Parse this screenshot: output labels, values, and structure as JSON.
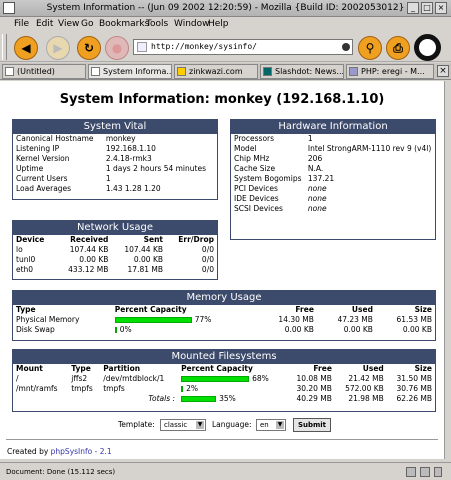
{
  "window": {
    "title": "System Information -- (Jun 09 2002 12:20:59) - Mozilla {Build ID: 2002053012}"
  },
  "menu": [
    "File",
    "Edit",
    "View",
    "Go",
    "Bookmarks",
    "Tools",
    "Window",
    "Help"
  ],
  "toolbar": {
    "url": "http://monkey/sysinfo/"
  },
  "tabs": [
    "(Untitled)",
    "System Informa...",
    "zinkwazi.com",
    "Slashdot: News...",
    "PHP: eregi - M..."
  ],
  "page": {
    "title": "System Information: monkey (192.168.1.10)"
  },
  "vital": {
    "heading": "System Vital",
    "rows": [
      {
        "k": "Canonical Hostname",
        "v": "monkey"
      },
      {
        "k": "Listening IP",
        "v": "192.168.1.10"
      },
      {
        "k": "Kernel Version",
        "v": "2.4.18-rmk3"
      },
      {
        "k": "Uptime",
        "v": "1 days 2 hours 54 minutes"
      },
      {
        "k": "Current Users",
        "v": "1"
      },
      {
        "k": "Load Averages",
        "v": "1.43 1.28 1.20"
      }
    ]
  },
  "hardware": {
    "heading": "Hardware Information",
    "rows": [
      {
        "k": "Processors",
        "v": "1"
      },
      {
        "k": "Model",
        "v": "Intel StrongARM-1110 rev 9 (v4l)"
      },
      {
        "k": "Chip MHz",
        "v": "206"
      },
      {
        "k": "Cache Size",
        "v": "N.A."
      },
      {
        "k": "System Bogomips",
        "v": "137.21"
      },
      {
        "k": "PCI Devices",
        "v": "none"
      },
      {
        "k": "IDE Devices",
        "v": "none"
      },
      {
        "k": "SCSI Devices",
        "v": "none"
      }
    ]
  },
  "network": {
    "heading": "Network Usage",
    "cols": [
      "Device",
      "Received",
      "Sent",
      "Err/Drop"
    ],
    "rows": [
      [
        "lo",
        "107.44 KB",
        "107.44 KB",
        "0/0"
      ],
      [
        "tunl0",
        "0.00 KB",
        "0.00 KB",
        "0/0"
      ],
      [
        "eth0",
        "433.12 MB",
        "17.81 MB",
        "0/0"
      ]
    ]
  },
  "memory": {
    "heading": "Memory Usage",
    "cols": [
      "Type",
      "Percent Capacity",
      "Free",
      "Used",
      "Size"
    ],
    "rows": [
      {
        "type": "Physical Memory",
        "pct": 77,
        "label": "77%",
        "free": "14.30 MB",
        "used": "47.23 MB",
        "size": "61.53 MB"
      },
      {
        "type": "Disk Swap",
        "pct": 0,
        "label": "0%",
        "free": "0.00 KB",
        "used": "0.00 KB",
        "size": "0.00 KB"
      }
    ]
  },
  "fs": {
    "heading": "Mounted Filesystems",
    "cols": [
      "Mount",
      "Type",
      "Partition",
      "Percent Capacity",
      "Free",
      "Used",
      "Size"
    ],
    "rows": [
      {
        "mount": "/",
        "type": "jffs2",
        "part": "/dev/mtdblock/1",
        "pct": 68,
        "label": "68%",
        "free": "10.08 MB",
        "used": "21.42 MB",
        "size": "31.50 MB"
      },
      {
        "mount": "/mnt/ramfs",
        "type": "tmpfs",
        "part": "tmpfs",
        "pct": 2,
        "label": "2%",
        "free": "30.20 MB",
        "used": "572.00 KB",
        "size": "30.76 MB"
      }
    ],
    "totals_label": "Totals :",
    "totals": {
      "pct": 35,
      "label": "35%",
      "free": "40.29 MB",
      "used": "21.98 MB",
      "size": "62.26 MB"
    }
  },
  "form": {
    "template_label": "Template:",
    "template_value": "classic",
    "language_label": "Language:",
    "language_value": "en",
    "submit": "Submit"
  },
  "footer": {
    "created_by": "Created by",
    "link": "phpSysInfo - 2.1"
  },
  "status": {
    "text": "Document: Done (15.112 secs)"
  },
  "colors": {
    "header": "#3c4a6b",
    "bar": "#00e000"
  }
}
